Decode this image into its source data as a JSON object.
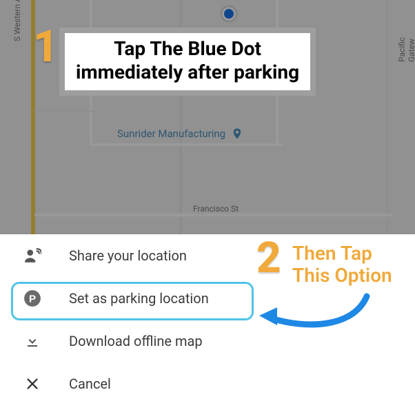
{
  "map": {
    "roads": {
      "western": "S Western Ave",
      "pacific": "Pacific Gatew",
      "francisco": "Francisco St"
    },
    "poi": {
      "name": "Sunrider Manufacturing"
    }
  },
  "step1": {
    "num": "1",
    "line1": "Tap The Blue Dot",
    "line2": "immediately after parking"
  },
  "step2": {
    "num": "2",
    "line1": "Then Tap",
    "line2": "This Option"
  },
  "sheet": {
    "items": [
      {
        "label": "Share your location"
      },
      {
        "label": "Set as parking location"
      },
      {
        "label": "Download offline map"
      },
      {
        "label": "Cancel"
      }
    ]
  }
}
